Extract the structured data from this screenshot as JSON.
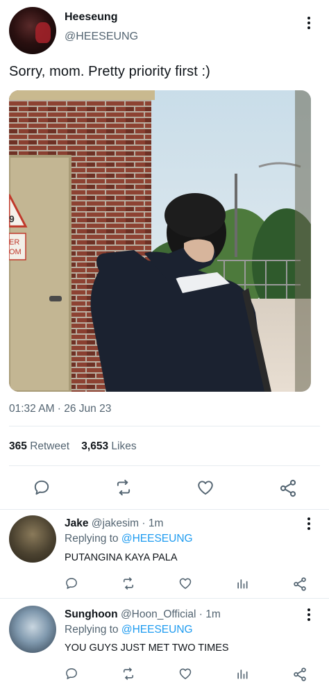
{
  "tweet": {
    "author_name": "Heeseung",
    "author_handle": "@HEESEUNG",
    "text": "Sorry, mom. Pretty priority first :)",
    "timestamp": "01:32 AM · 26 Jun 23",
    "retweet_count": "365",
    "retweet_label": "Retweet",
    "likes_count": "3,653",
    "likes_label": "Likes",
    "photo_sign_text_1": "9",
    "photo_sign_text_2": "ER",
    "photo_sign_text_3": "OM"
  },
  "replies": [
    {
      "name": "Jake",
      "handle": "@jakesim",
      "time": "· 1m",
      "replying_prefix": "Replying to",
      "replying_to": "@HEESEUNG",
      "text": "PUTANGINA KAYA PALA"
    },
    {
      "name": "Sunghoon",
      "handle": "@Hoon_Official",
      "time": "· 1m",
      "replying_prefix": "Replying to",
      "replying_to": "@HEESEUNG",
      "text": "YOU GUYS JUST MET TWO TIMES"
    }
  ],
  "icons": {
    "reply": "reply-icon",
    "retweet": "retweet-icon",
    "like": "heart-icon",
    "views": "views-icon",
    "share": "share-icon",
    "more": "more-vertical-icon"
  },
  "colors": {
    "text": "#0f1419",
    "secondary": "#536471",
    "link": "#1d9bf0",
    "divider": "#e6ecf0"
  }
}
